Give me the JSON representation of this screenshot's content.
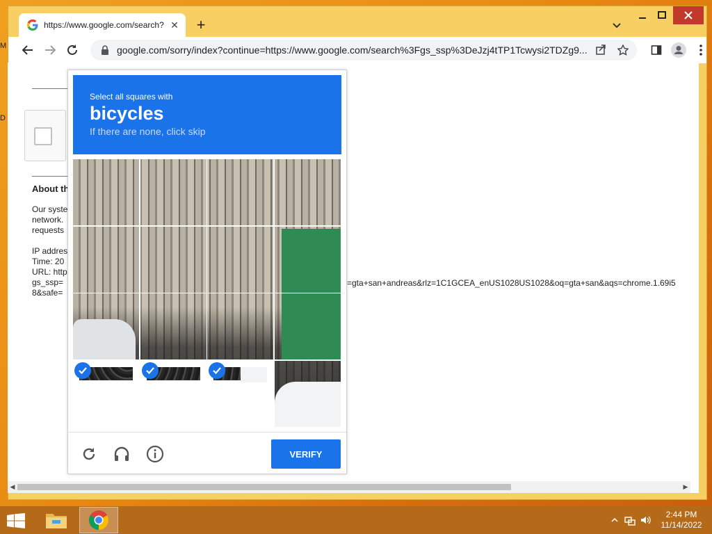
{
  "desktop": {
    "edge_chars": [
      "M",
      "D"
    ]
  },
  "browser": {
    "tab": {
      "title": "https://www.google.com/search?",
      "close": "✕"
    },
    "new_tab": "+",
    "omnibox": {
      "url": "google.com/sorry/index?continue=https://www.google.com/search%3Fgs_ssp%3DeJzj4tTP1Tcwysi2TDZg9..."
    }
  },
  "page": {
    "heading_fragment": "About th",
    "lines": [
      "Our syste",
      "network.",
      "requests",
      "IP addres",
      "Time: 20",
      "URL: http",
      "gs_ssp=",
      "8&safe="
    ],
    "url_tail": "=gta+san+andreas&rlz=1C1GCEA_enUS1028US1028&oq=gta+san&aqs=chrome.1.69i5"
  },
  "captcha": {
    "instruction": "Select all squares with",
    "target": "bicycles",
    "hint": "If there are none, click skip",
    "verify_label": "VERIFY",
    "selected_tiles": [
      12,
      13,
      14
    ]
  },
  "taskbar": {
    "time": "2:44 PM",
    "date": "11/14/2022"
  }
}
